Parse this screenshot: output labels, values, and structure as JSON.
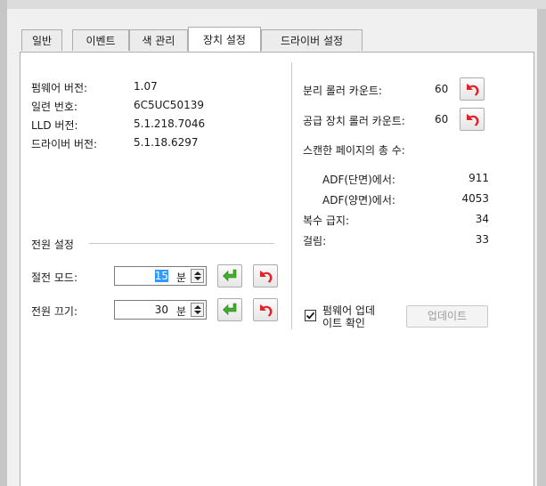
{
  "tabs": [
    "일반",
    "이벤트",
    "색 관리",
    "장치 설정",
    "드라이버 설정"
  ],
  "active_tab": "장치 설정",
  "device_info": {
    "firmware_label": "펌웨어 버전:",
    "firmware_value": "1.07",
    "serial_label": "일련 번호:",
    "serial_value": "6C5UC50139",
    "lld_label": "LLD 버전:",
    "lld_value": "5.1.218.7046",
    "driver_label": "드라이버 버전:",
    "driver_value": "5.1.18.6297"
  },
  "power": {
    "group_label": "전원 설정",
    "sleep_label": "절전 모드:",
    "sleep_value": "15",
    "off_label": "전원 끄기:",
    "off_value": "30",
    "unit": "분"
  },
  "counters": {
    "separation_label": "분리 롤러 카운트:",
    "separation_value": "60",
    "feed_label": "공급 장치 롤러 카운트:",
    "feed_value": "60",
    "total_label": "스캔한 페이지의 총 수:",
    "simplex_label": "ADF(단면)에서:",
    "simplex_value": "911",
    "duplex_label": "ADF(양면)에서:",
    "duplex_value": "4053",
    "multifeed_label": "복수 급지:",
    "multifeed_value": "34",
    "jam_label": "걸림:",
    "jam_value": "33"
  },
  "firmware_update": {
    "check_line1": "펌웨어 업데",
    "check_line2": "이트 확인",
    "checked": true,
    "update_button": "업데이트"
  },
  "icons": {
    "apply": "green-enter-arrow-icon",
    "reset": "red-undo-arrow-icon",
    "apply_color": "#3fae2a",
    "reset_color": "#e0242c"
  }
}
